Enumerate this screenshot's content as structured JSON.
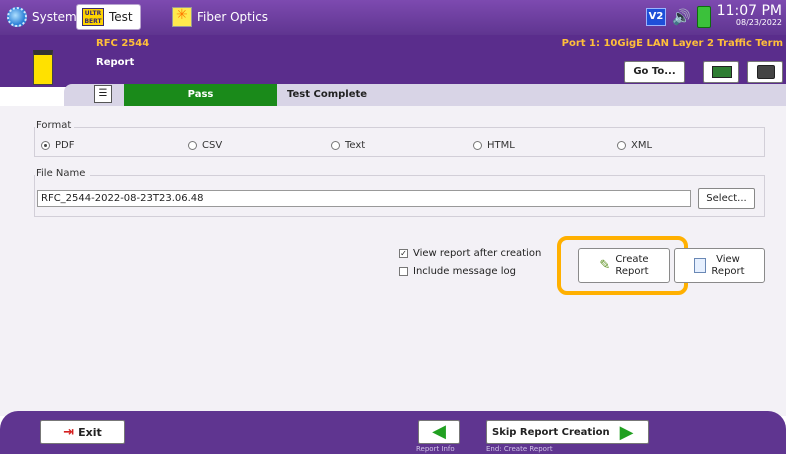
{
  "topbar": {
    "tabs": [
      {
        "label": "System",
        "icon": "gear-icon"
      },
      {
        "label": "Test",
        "icon": "bert-icon",
        "icon_text": "ULTR BERT"
      },
      {
        "label": "Fiber Optics",
        "icon": "fiber-optics-icon"
      }
    ],
    "status": {
      "network_badge": "V2",
      "time": "11:07 PM",
      "date": "08/23/2022"
    }
  },
  "header": {
    "test_name": "RFC 2544",
    "sub_title": "Report",
    "port_label": "Port 1: 10GigE LAN Layer 2 Traffic Term",
    "goto_label": "Go To..."
  },
  "status_strip": {
    "result": "Pass",
    "state": "Test Complete",
    "result_color": "#1a8a1a"
  },
  "format": {
    "label": "Format",
    "options": [
      "PDF",
      "CSV",
      "Text",
      "HTML",
      "XML"
    ],
    "selected": "PDF"
  },
  "file": {
    "label": "File Name",
    "value": "RFC_2544-2022-08-23T23.06.48",
    "select_label": "Select..."
  },
  "options": {
    "view_after": {
      "label": "View report after creation",
      "checked": true
    },
    "include_log": {
      "label": "Include message log",
      "checked": false
    }
  },
  "actions": {
    "create_line1": "Create",
    "create_line2": "Report",
    "view_line1": "View",
    "view_line2": "Report",
    "highlight_color": "#ffb000"
  },
  "footer": {
    "exit_label": "Exit",
    "prev_caption": "Report Info",
    "next_label": "Skip Report Creation",
    "next_caption": "End: Create Report"
  }
}
